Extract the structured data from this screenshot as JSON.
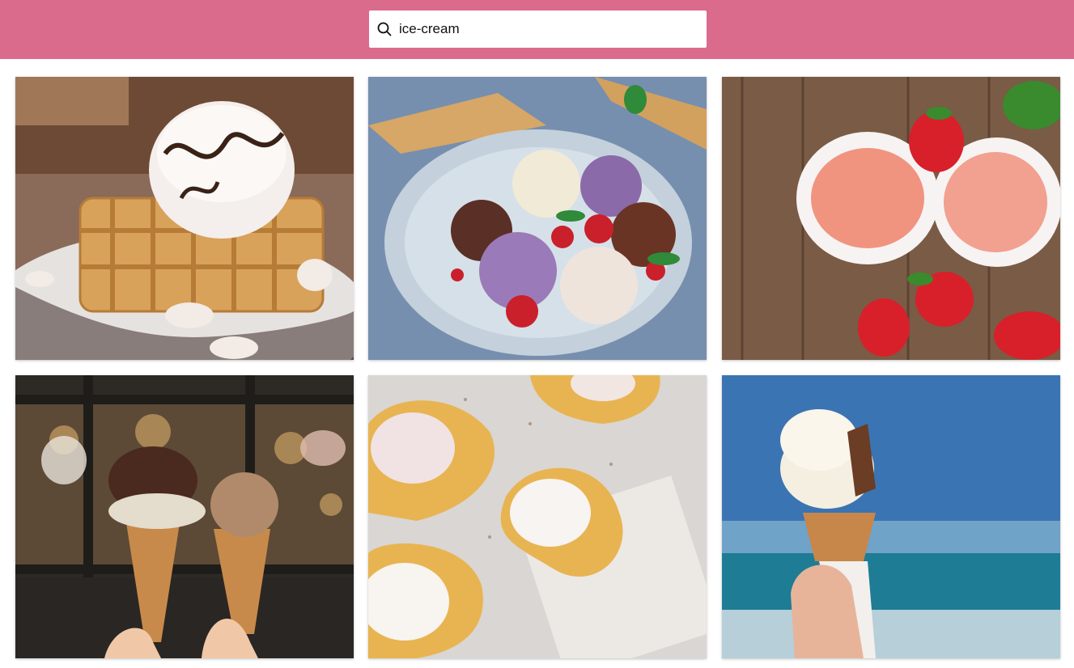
{
  "search": {
    "value": "ice-cream",
    "icon": "search-icon"
  },
  "colors": {
    "topbar": "#db6b8d",
    "search_bg": "#ffffff"
  },
  "gallery": {
    "images": [
      {
        "subject": "ice-cream-waffle-chocolate-photo"
      },
      {
        "subject": "ice-cream-scoops-bowl-berries-photo"
      },
      {
        "subject": "pink-sorbet-strawberries-photo"
      },
      {
        "subject": "two-ice-cream-cones-shopfront-photo"
      },
      {
        "subject": "heart-waffles-ice-cream-photo"
      },
      {
        "subject": "soft-serve-cone-beach-photo"
      }
    ]
  }
}
